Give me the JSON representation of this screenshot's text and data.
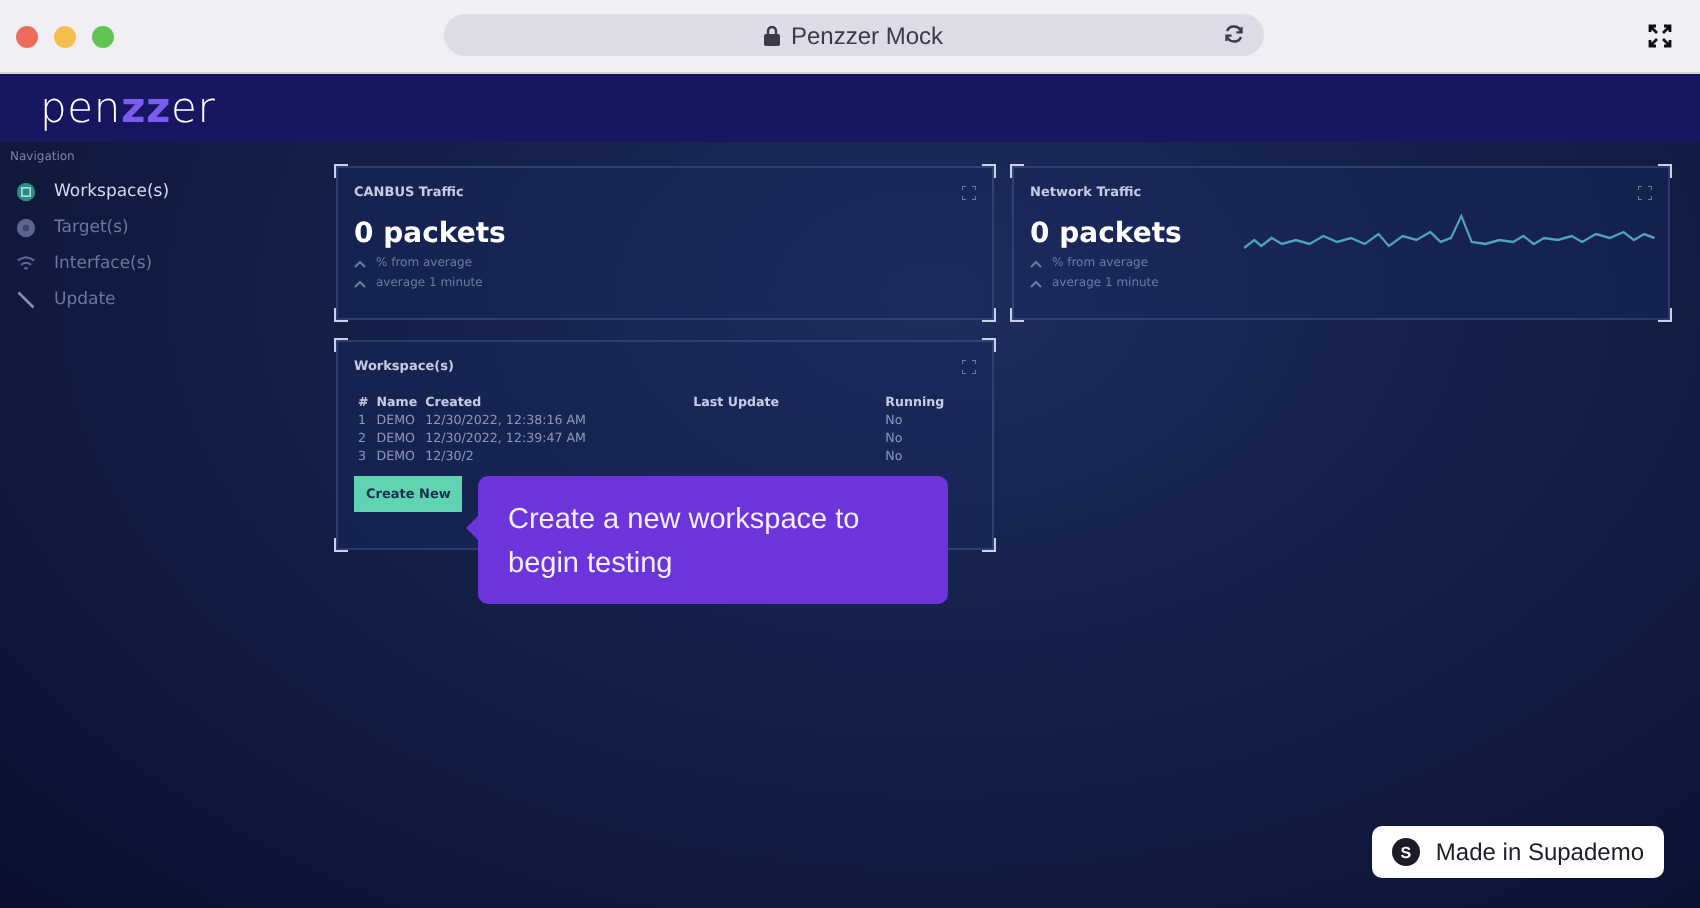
{
  "browser": {
    "title": "Penzzer Mock"
  },
  "logo": "pen**zz**er",
  "sidebar": {
    "heading": "Navigation",
    "items": [
      {
        "label": "Workspace(s)",
        "selected": true
      },
      {
        "label": "Target(s)",
        "selected": false
      },
      {
        "label": "Interface(s)",
        "selected": false
      },
      {
        "label": "Update",
        "selected": false
      }
    ]
  },
  "cards": [
    {
      "title": "CANBUS Traffic",
      "value": "0 packets",
      "stats": [
        "% from average",
        "average 1 minute"
      ],
      "sparkline": false
    },
    {
      "title": "Network Traffic",
      "value": "0 packets",
      "stats": [
        "% from average",
        "average 1 minute"
      ],
      "sparkline": true
    }
  ],
  "workspaces": {
    "title": "Workspace(s)",
    "columns": [
      "#",
      "Name",
      "Created",
      "Last Update",
      "Running"
    ],
    "rows": [
      [
        "1",
        "DEMO",
        "12/30/2022, 12:38:16 AM",
        "",
        "No"
      ],
      [
        "2",
        "DEMO",
        "12/30/2022, 12:39:47 AM",
        "",
        "No"
      ],
      [
        "3",
        "DEMO",
        "12/30/2",
        "",
        "No"
      ]
    ],
    "button": "Create New"
  },
  "tooltip": "Create a new workspace to begin testing",
  "badge": {
    "icon": "S",
    "label": "Made in Supademo"
  }
}
